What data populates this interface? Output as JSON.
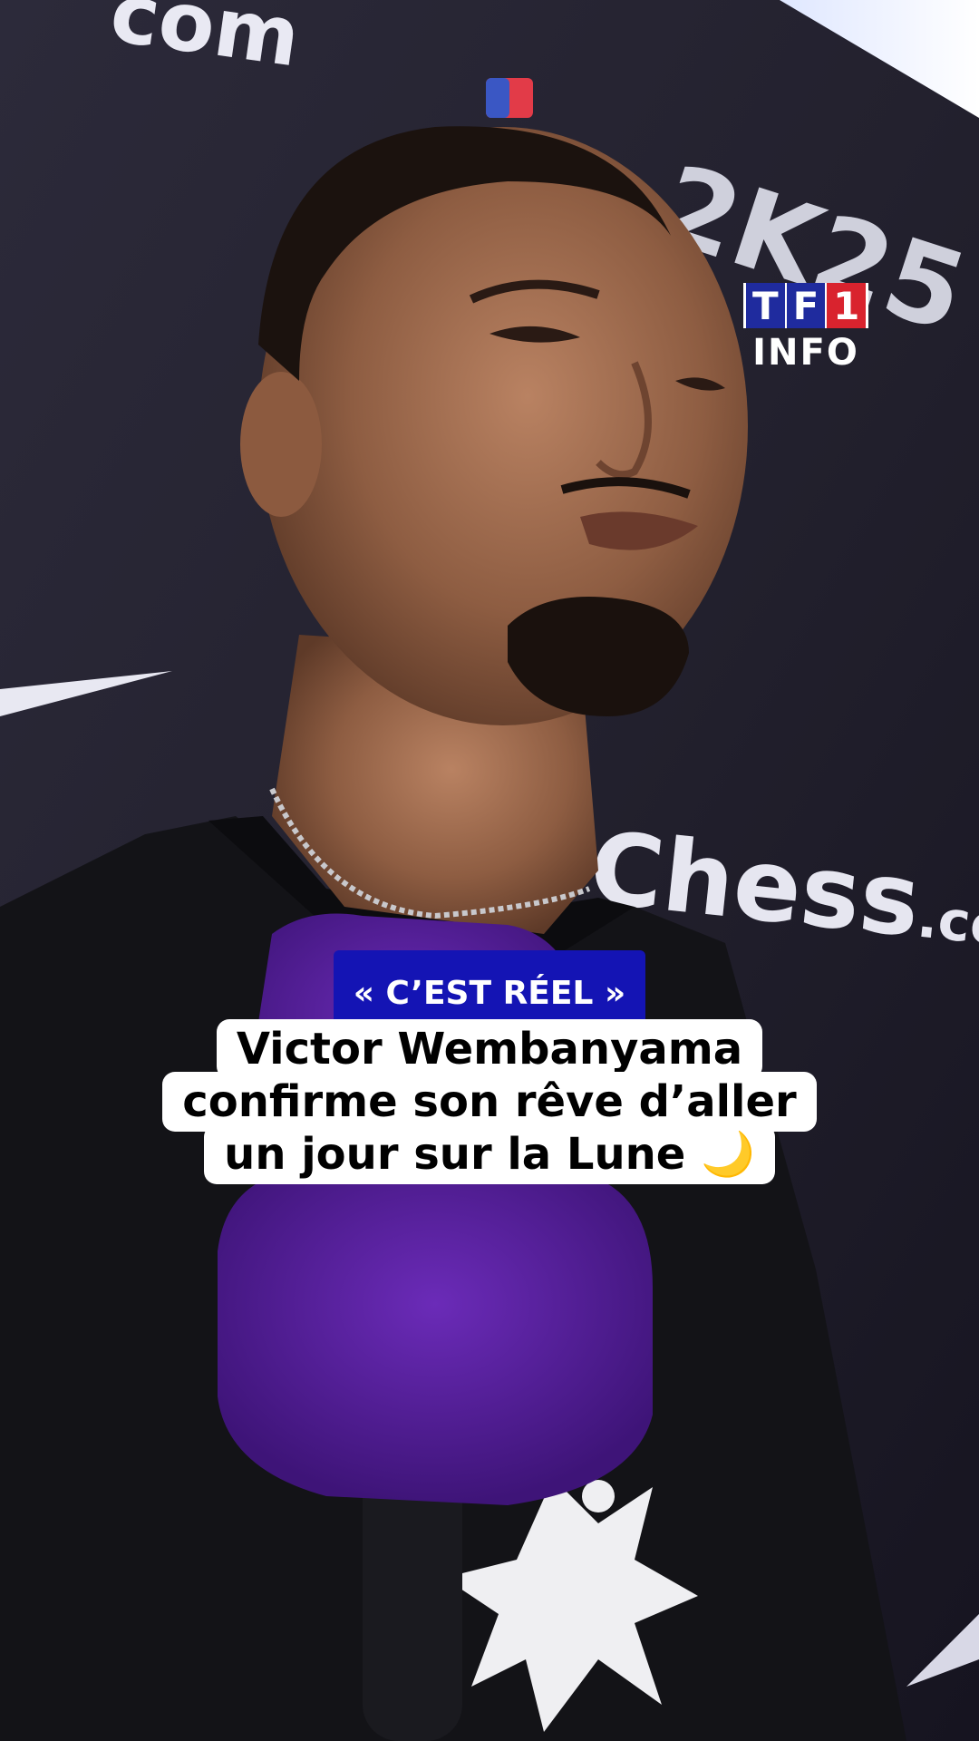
{
  "brand": {
    "logo_top": [
      "T",
      "F",
      "1"
    ],
    "logo_bottom": "INFO",
    "colors": {
      "blue": "#1f2b9e",
      "red": "#d9232e",
      "white": "#ffffff"
    }
  },
  "backdrop": {
    "text_top": ".com",
    "text_middle": "Chess.com",
    "text_corner": "2K25"
  },
  "caption": {
    "tag": "« C’EST RÉEL »",
    "tag_color": "#1414b4",
    "lines": [
      "Victor Wembanyama",
      "confirme son rêve d’aller",
      "un jour sur la Lune 🌙"
    ]
  }
}
